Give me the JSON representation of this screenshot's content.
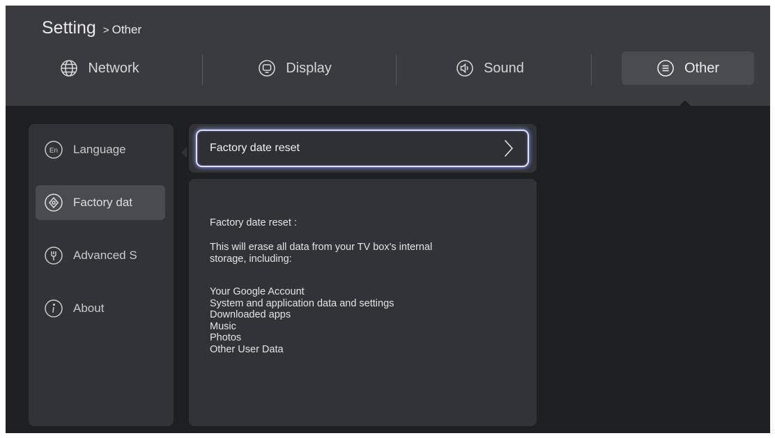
{
  "breadcrumb": {
    "title": "Setting",
    "separator": ">",
    "current": "Other"
  },
  "tabs": [
    {
      "label": "Network",
      "icon": "globe-icon",
      "active": false
    },
    {
      "label": "Display",
      "icon": "display-icon",
      "active": false
    },
    {
      "label": "Sound",
      "icon": "speaker-icon",
      "active": false
    },
    {
      "label": "Other",
      "icon": "menu-icon",
      "active": true
    }
  ],
  "sidebar": {
    "items": [
      {
        "label": "Language",
        "icon": "language-icon",
        "active": false
      },
      {
        "label": "Factory dat",
        "icon": "factory-reset-icon",
        "active": true
      },
      {
        "label": "Advanced S",
        "icon": "advanced-settings-icon",
        "active": false
      },
      {
        "label": "About",
        "icon": "info-icon",
        "active": false
      }
    ]
  },
  "option": {
    "label": "Factory date reset"
  },
  "detail": {
    "title": "Factory date reset :",
    "description_line1": "This will erase all data from your TV box's internal",
    "description_line2": "storage, including:",
    "items": [
      "Your Google Account",
      "System and application data and settings",
      "Downloaded apps",
      "Music",
      "Photos",
      "Other User Data"
    ]
  },
  "colors": {
    "background": "#1e1f21",
    "header": "#3a3b3e",
    "panel": "#323336",
    "active_item": "#4a4b4f",
    "focus_glow": "#8c96ff"
  }
}
